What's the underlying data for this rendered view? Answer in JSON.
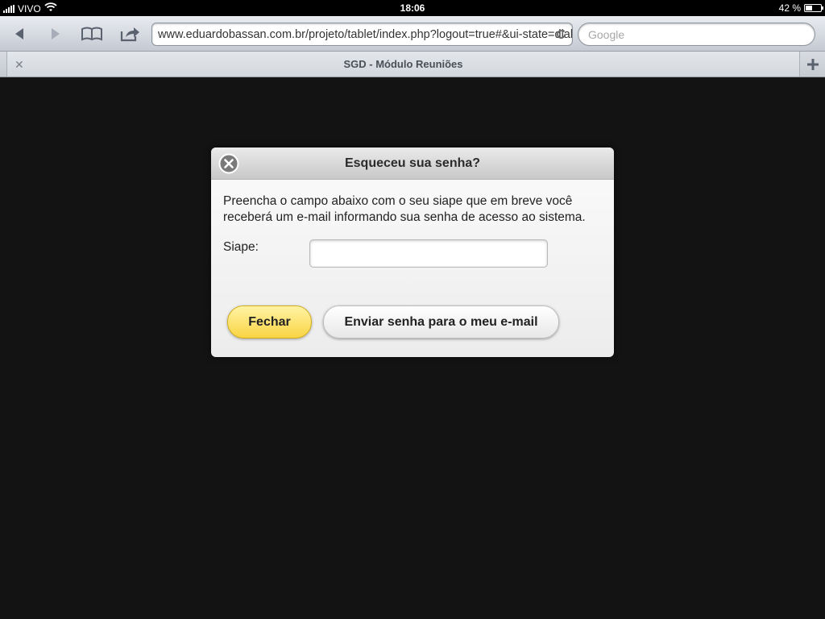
{
  "status_bar": {
    "carrier": "VIVO",
    "time": "18:06",
    "battery": "42 %",
    "battery_level": 0.42
  },
  "toolbar": {
    "url": "www.eduardobassan.com.br/projeto/tablet/index.php?logout=true#&ui-state=dialog",
    "search_placeholder": "Google"
  },
  "tab": {
    "title": "SGD - Módulo Reuniões"
  },
  "dialog": {
    "title": "Esqueceu sua senha?",
    "message": "Preencha o campo abaixo com o seu siape que em breve você receberá um e-mail informando sua senha de acesso ao sistema.",
    "siape_label": "Siape:",
    "siape_value": "",
    "close_label": "Fechar",
    "send_label": "Enviar senha para o meu e-mail"
  },
  "colors": {
    "primary_button": "#f9d443",
    "overlay": "#131313"
  }
}
